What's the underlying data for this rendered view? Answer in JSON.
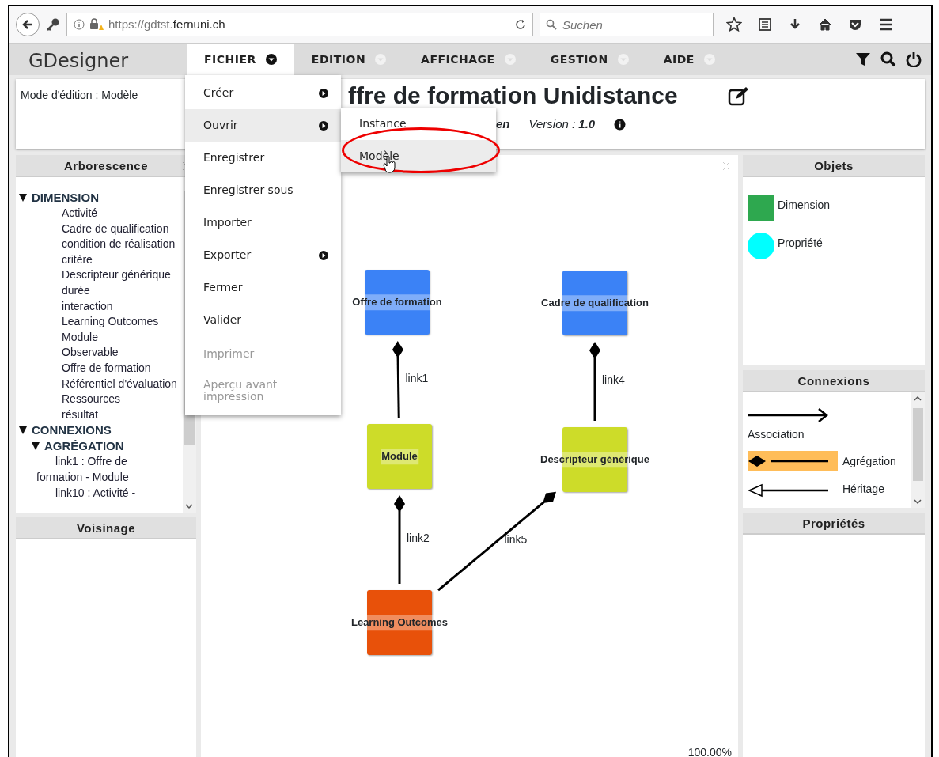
{
  "browser": {
    "url_host": "https://gdtst.",
    "url_domain": "fernuni.ch",
    "search": {
      "placeholder": "Suchen"
    }
  },
  "app": {
    "brand": "GDesigner",
    "menus": [
      {
        "label": "FICHIER",
        "selected": true
      },
      {
        "label": "EDITION",
        "selected": false
      },
      {
        "label": "AFFICHAGE",
        "selected": false
      },
      {
        "label": "GESTION",
        "selected": false
      },
      {
        "label": "AIDE",
        "selected": false
      }
    ]
  },
  "file_menu": [
    {
      "label": "Créer",
      "submenu": true,
      "selected": false,
      "disabled": false
    },
    {
      "label": "Ouvrir",
      "submenu": true,
      "selected": true,
      "disabled": false
    },
    {
      "label": "Enregistrer",
      "submenu": false,
      "selected": false,
      "disabled": false
    },
    {
      "label": "Enregistrer sous",
      "submenu": false,
      "selected": false,
      "disabled": false
    },
    {
      "label": "Importer",
      "submenu": false,
      "selected": false,
      "disabled": false
    },
    {
      "label": "Exporter",
      "submenu": true,
      "selected": false,
      "disabled": false
    },
    {
      "label": "Fermer",
      "submenu": false,
      "selected": false,
      "disabled": false
    },
    {
      "label": "Valider",
      "submenu": false,
      "selected": false,
      "disabled": false
    },
    {
      "label": "Imprimer",
      "submenu": false,
      "selected": false,
      "disabled": true
    },
    {
      "label": "Aperçu avant impression",
      "submenu": false,
      "selected": false,
      "disabled": true
    }
  ],
  "open_submenu": [
    {
      "label": "Instance",
      "selected": false
    },
    {
      "label": "Modèle",
      "selected": true
    }
  ],
  "mode": "Mode d'édition : Modèle",
  "document": {
    "title": "ffre de formation Unidistance",
    "author_fragment": "en",
    "version_label": "Version :",
    "version": "1.0"
  },
  "tree_panel": {
    "title": "Arborescence",
    "items": [
      {
        "label": "DIMENSION",
        "expanded": true,
        "children": [
          {
            "label": "Activité"
          },
          {
            "label": "Cadre de qualification"
          },
          {
            "label": "condition de réalisation"
          },
          {
            "label": "critère"
          },
          {
            "label": "Descripteur générique"
          },
          {
            "label": "durée"
          },
          {
            "label": "interaction"
          },
          {
            "label": "Learning Outcomes"
          },
          {
            "label": "Module"
          },
          {
            "label": "Observable"
          },
          {
            "label": "Offre de formation"
          },
          {
            "label": "Référentiel d'évaluation"
          },
          {
            "label": "Ressources"
          },
          {
            "label": "résultat"
          }
        ]
      },
      {
        "label": "CONNEXIONS",
        "expanded": true,
        "children": [
          {
            "label": "AGRÉGATION",
            "expanded": true,
            "children": [
              {
                "label": "link1 : Offre de formation - Module"
              },
              {
                "label": "link10 : Activité -"
              }
            ]
          }
        ]
      }
    ]
  },
  "neighborhood_panel": {
    "title": "Voisinage"
  },
  "diagram": {
    "nodes": [
      {
        "label": "Offre de formation",
        "color": "#3b82f6"
      },
      {
        "label": "Cadre de qualification",
        "color": "#3b82f6"
      },
      {
        "label": "Module",
        "color": "#cddc29"
      },
      {
        "label": "Descripteur générique",
        "color": "#cddc29"
      },
      {
        "label": "Learning Outcomes",
        "color": "#e8510a"
      }
    ],
    "links": [
      {
        "label": "link1",
        "kind": "aggregation"
      },
      {
        "label": "link4",
        "kind": "aggregation"
      },
      {
        "label": "link2",
        "kind": "aggregation"
      },
      {
        "label": "link5",
        "kind": "aggregation"
      }
    ],
    "zoom": "100.00%"
  },
  "objects_panel": {
    "title": "Objets",
    "items": [
      {
        "label": "Dimension",
        "kind": "square",
        "color": "#2ea84f"
      },
      {
        "label": "Propriété",
        "kind": "circle",
        "color": "#00ffff"
      }
    ]
  },
  "connections_panel": {
    "title": "Connexions",
    "items": [
      {
        "label": "Association",
        "kind": "association",
        "selected": false
      },
      {
        "label": "Agrégation",
        "kind": "aggregation",
        "selected": true
      },
      {
        "label": "Héritage",
        "kind": "inheritance",
        "selected": false
      }
    ]
  },
  "properties_panel": {
    "title": "Propriétés"
  }
}
